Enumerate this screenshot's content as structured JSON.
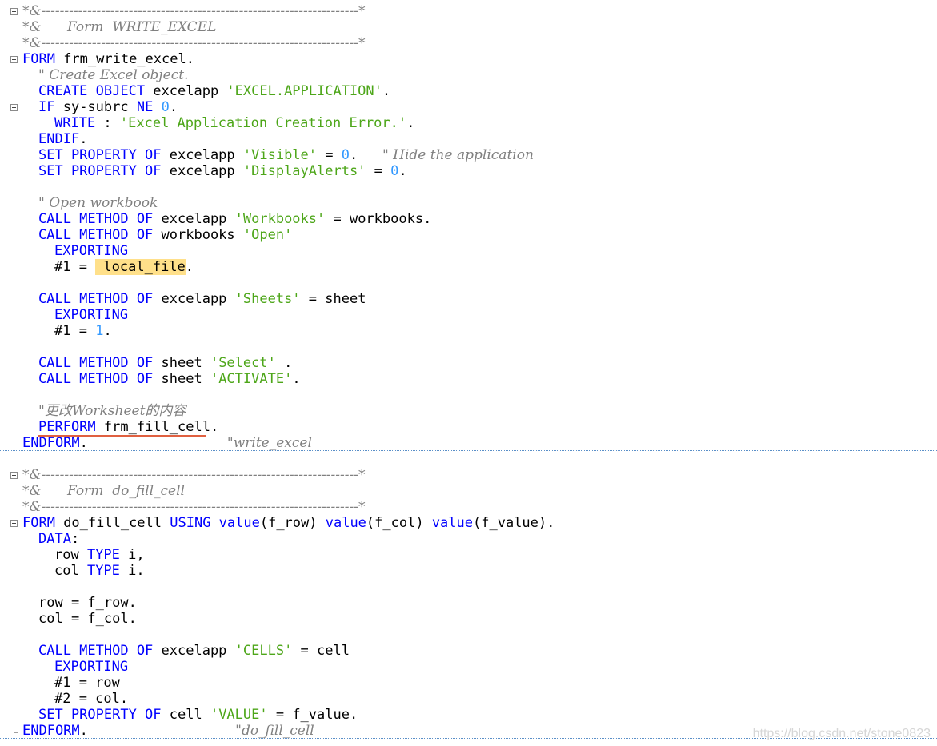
{
  "editor": {
    "lines": [
      {
        "folder": "header-open",
        "indent": 0,
        "tokens": [
          {
            "t": "cmt",
            "v": "*&---------------------------------------------------------------------*"
          }
        ]
      },
      {
        "folder": "",
        "indent": 0,
        "tokens": [
          {
            "t": "cmt",
            "v": "*&      Form  WRITE_EXCEL"
          }
        ]
      },
      {
        "folder": "",
        "indent": 0,
        "tokens": [
          {
            "t": "cmt",
            "v": "*&---------------------------------------------------------------------*"
          }
        ]
      },
      {
        "folder": "form-open",
        "indent": 0,
        "tokens": [
          {
            "t": "kw",
            "v": "FORM"
          },
          {
            "t": "id",
            "v": " frm_write_excel."
          }
        ]
      },
      {
        "folder": "",
        "indent": 2,
        "tokens": [
          {
            "t": "cmt",
            "v": "\" Create Excel object."
          }
        ]
      },
      {
        "folder": "",
        "indent": 2,
        "tokens": [
          {
            "t": "kw",
            "v": "CREATE OBJECT"
          },
          {
            "t": "id",
            "v": " excelapp "
          },
          {
            "t": "str",
            "v": "'EXCEL.APPLICATION'"
          },
          {
            "t": "id",
            "v": "."
          }
        ]
      },
      {
        "folder": "if-open",
        "indent": 2,
        "tokens": [
          {
            "t": "kw",
            "v": "IF"
          },
          {
            "t": "id",
            "v": " sy-subrc "
          },
          {
            "t": "kw",
            "v": "NE"
          },
          {
            "t": "id",
            "v": " "
          },
          {
            "t": "num",
            "v": "0"
          },
          {
            "t": "id",
            "v": "."
          }
        ]
      },
      {
        "folder": "",
        "indent": 4,
        "tokens": [
          {
            "t": "kw",
            "v": "WRITE"
          },
          {
            "t": "id",
            "v": " : "
          },
          {
            "t": "str",
            "v": "'Excel Application Creation Error.'"
          },
          {
            "t": "id",
            "v": "."
          }
        ]
      },
      {
        "folder": "",
        "indent": 2,
        "tokens": [
          {
            "t": "kw",
            "v": "ENDIF"
          },
          {
            "t": "id",
            "v": "."
          }
        ]
      },
      {
        "folder": "",
        "indent": 2,
        "tokens": [
          {
            "t": "kw",
            "v": "SET PROPERTY OF"
          },
          {
            "t": "id",
            "v": " excelapp "
          },
          {
            "t": "str",
            "v": "'Visible'"
          },
          {
            "t": "id",
            "v": " = "
          },
          {
            "t": "num",
            "v": "0"
          },
          {
            "t": "id",
            "v": ".   "
          },
          {
            "t": "cmt",
            "v": "\" Hide the application"
          }
        ]
      },
      {
        "folder": "",
        "indent": 2,
        "tokens": [
          {
            "t": "kw",
            "v": "SET PROPERTY OF"
          },
          {
            "t": "id",
            "v": " excelapp "
          },
          {
            "t": "str",
            "v": "'DisplayAlerts'"
          },
          {
            "t": "id",
            "v": " = "
          },
          {
            "t": "num",
            "v": "0"
          },
          {
            "t": "id",
            "v": "."
          }
        ]
      },
      {
        "folder": "",
        "indent": 0,
        "tokens": []
      },
      {
        "folder": "",
        "indent": 2,
        "tokens": [
          {
            "t": "cmt",
            "v": "\" Open workbook"
          }
        ]
      },
      {
        "folder": "",
        "indent": 2,
        "tokens": [
          {
            "t": "kw",
            "v": "CALL METHOD OF"
          },
          {
            "t": "id",
            "v": " excelapp "
          },
          {
            "t": "str",
            "v": "'Workbooks'"
          },
          {
            "t": "id",
            "v": " = workbooks."
          }
        ]
      },
      {
        "folder": "",
        "indent": 2,
        "tokens": [
          {
            "t": "kw",
            "v": "CALL METHOD OF"
          },
          {
            "t": "id",
            "v": " workbooks "
          },
          {
            "t": "str",
            "v": "'Open'"
          }
        ]
      },
      {
        "folder": "",
        "indent": 4,
        "tokens": [
          {
            "t": "kw",
            "v": "EXPORTING"
          }
        ]
      },
      {
        "folder": "",
        "indent": 4,
        "tokens": [
          {
            "t": "id",
            "v": "#1 = "
          },
          {
            "t": "hl",
            "v": " local_file"
          },
          {
            "t": "id",
            "v": "."
          }
        ]
      },
      {
        "folder": "",
        "indent": 0,
        "tokens": []
      },
      {
        "folder": "",
        "indent": 2,
        "tokens": [
          {
            "t": "kw",
            "v": "CALL METHOD OF"
          },
          {
            "t": "id",
            "v": " excelapp "
          },
          {
            "t": "str",
            "v": "'Sheets'"
          },
          {
            "t": "id",
            "v": " = sheet"
          }
        ]
      },
      {
        "folder": "",
        "indent": 4,
        "tokens": [
          {
            "t": "kw",
            "v": "EXPORTING"
          }
        ]
      },
      {
        "folder": "",
        "indent": 4,
        "tokens": [
          {
            "t": "id",
            "v": "#1 = "
          },
          {
            "t": "num",
            "v": "1"
          },
          {
            "t": "id",
            "v": "."
          }
        ]
      },
      {
        "folder": "",
        "indent": 0,
        "tokens": []
      },
      {
        "folder": "",
        "indent": 2,
        "tokens": [
          {
            "t": "kw",
            "v": "CALL METHOD OF"
          },
          {
            "t": "id",
            "v": " sheet "
          },
          {
            "t": "str",
            "v": "'Select'"
          },
          {
            "t": "id",
            "v": " ."
          }
        ]
      },
      {
        "folder": "",
        "indent": 2,
        "tokens": [
          {
            "t": "kw",
            "v": "CALL METHOD OF"
          },
          {
            "t": "id",
            "v": " sheet "
          },
          {
            "t": "str",
            "v": "'ACTIVATE'"
          },
          {
            "t": "id",
            "v": "."
          }
        ]
      },
      {
        "folder": "",
        "indent": 0,
        "tokens": []
      },
      {
        "folder": "",
        "indent": 2,
        "tokens": [
          {
            "t": "cmt",
            "v": "\"更改Worksheet的内容"
          }
        ]
      },
      {
        "folder": "",
        "indent": 2,
        "tokens": [
          {
            "t": "kw",
            "v": "PERFORM"
          },
          {
            "t": "id",
            "v": " frm_fill_cell."
          }
        ]
      },
      {
        "folder": "form-end",
        "indent": 0,
        "tokens": [
          {
            "t": "kw",
            "v": "ENDFORM"
          },
          {
            "t": "id",
            "v": ".                 "
          },
          {
            "t": "cmt",
            "v": "\"write_excel"
          }
        ]
      },
      {
        "folder": "",
        "indent": 0,
        "tokens": []
      },
      {
        "folder": "header-open",
        "indent": 0,
        "tokens": [
          {
            "t": "cmt",
            "v": "*&---------------------------------------------------------------------*"
          }
        ]
      },
      {
        "folder": "",
        "indent": 0,
        "tokens": [
          {
            "t": "cmt",
            "v": "*&      Form  do_fill_cell"
          }
        ]
      },
      {
        "folder": "",
        "indent": 0,
        "tokens": [
          {
            "t": "cmt",
            "v": "*&---------------------------------------------------------------------*"
          }
        ]
      },
      {
        "folder": "form-open",
        "indent": 0,
        "tokens": [
          {
            "t": "kw",
            "v": "FORM"
          },
          {
            "t": "id",
            "v": " do_fill_cell "
          },
          {
            "t": "kw",
            "v": "USING value"
          },
          {
            "t": "id",
            "v": "(f_row) "
          },
          {
            "t": "kw",
            "v": "value"
          },
          {
            "t": "id",
            "v": "(f_col) "
          },
          {
            "t": "kw",
            "v": "value"
          },
          {
            "t": "id",
            "v": "(f_value)."
          }
        ]
      },
      {
        "folder": "",
        "indent": 2,
        "tokens": [
          {
            "t": "kw",
            "v": "DATA"
          },
          {
            "t": "id",
            "v": ":"
          }
        ]
      },
      {
        "folder": "",
        "indent": 4,
        "tokens": [
          {
            "t": "id",
            "v": "row "
          },
          {
            "t": "kw",
            "v": "TYPE"
          },
          {
            "t": "id",
            "v": " i,"
          }
        ]
      },
      {
        "folder": "",
        "indent": 4,
        "tokens": [
          {
            "t": "id",
            "v": "col "
          },
          {
            "t": "kw",
            "v": "TYPE"
          },
          {
            "t": "id",
            "v": " i."
          }
        ]
      },
      {
        "folder": "",
        "indent": 0,
        "tokens": []
      },
      {
        "folder": "",
        "indent": 2,
        "tokens": [
          {
            "t": "id",
            "v": "row = f_row."
          }
        ]
      },
      {
        "folder": "",
        "indent": 2,
        "tokens": [
          {
            "t": "id",
            "v": "col = f_col."
          }
        ]
      },
      {
        "folder": "",
        "indent": 0,
        "tokens": []
      },
      {
        "folder": "",
        "indent": 2,
        "tokens": [
          {
            "t": "kw",
            "v": "CALL METHOD OF"
          },
          {
            "t": "id",
            "v": " excelapp "
          },
          {
            "t": "str",
            "v": "'CELLS'"
          },
          {
            "t": "id",
            "v": " = cell"
          }
        ]
      },
      {
        "folder": "",
        "indent": 4,
        "tokens": [
          {
            "t": "kw",
            "v": "EXPORTING"
          }
        ]
      },
      {
        "folder": "",
        "indent": 4,
        "tokens": [
          {
            "t": "id",
            "v": "#1 = row"
          }
        ]
      },
      {
        "folder": "",
        "indent": 4,
        "tokens": [
          {
            "t": "id",
            "v": "#2 = col."
          }
        ]
      },
      {
        "folder": "",
        "indent": 2,
        "tokens": [
          {
            "t": "kw",
            "v": "SET PROPERTY OF"
          },
          {
            "t": "id",
            "v": " cell "
          },
          {
            "t": "str",
            "v": "'VALUE'"
          },
          {
            "t": "id",
            "v": " = f_value."
          }
        ]
      },
      {
        "folder": "form-end",
        "indent": 0,
        "tokens": [
          {
            "t": "kw",
            "v": "ENDFORM"
          },
          {
            "t": "id",
            "v": ".                  "
          },
          {
            "t": "cmt",
            "v": "\"do_fill_cell"
          }
        ]
      }
    ]
  },
  "watermark": "https://blog.csdn.net/stone0823",
  "colors": {
    "keyword": "#0000ff",
    "string": "#4da619",
    "number": "#3399ff",
    "comment": "#808080",
    "highlight": "#ffe08a",
    "squiggle": "#e06040"
  },
  "icons": {
    "fold": "fold-minus-icon"
  }
}
